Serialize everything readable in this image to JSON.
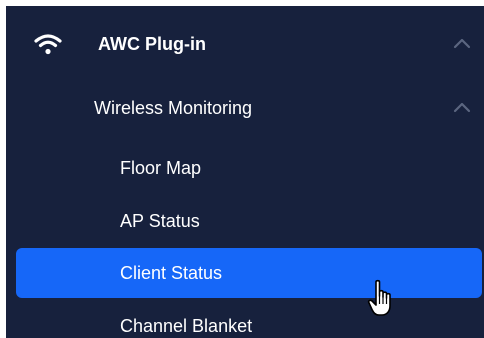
{
  "nav": {
    "group": {
      "label": "AWC Plug-in",
      "icon": "wifi-icon",
      "expanded": true
    },
    "subgroup": {
      "label": "Wireless Monitoring",
      "expanded": true
    },
    "items": [
      {
        "label": "Floor Map",
        "active": false
      },
      {
        "label": "AP Status",
        "active": false
      },
      {
        "label": "Client Status",
        "active": true
      },
      {
        "label": "Channel Blanket",
        "active": false
      }
    ]
  },
  "colors": {
    "sidebar_bg": "#17213d",
    "active_bg": "#1667f8",
    "text": "#ffffff",
    "chevron": "#5b6680"
  },
  "cursor": {
    "icon": "hand-pointer-icon"
  }
}
